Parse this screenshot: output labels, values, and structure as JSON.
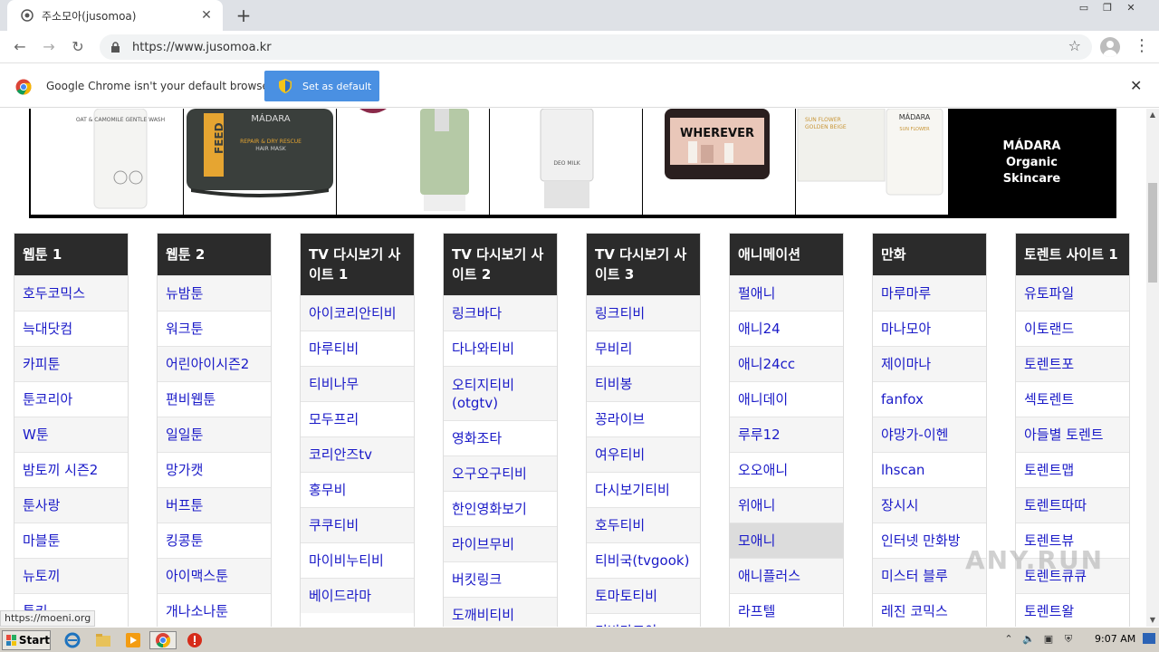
{
  "browser": {
    "tab_title": "주소모아(jusomoa)",
    "url": "https://www.jusomoa.kr"
  },
  "infobar": {
    "message": "Google Chrome isn't your default browser",
    "button": "Set as default"
  },
  "banner": {
    "ad_text": "MÁDARA\nOrganic\nSkincare",
    "product_labels": [
      "OAT & CAMOMILE GENTLE WASH",
      "MÁDARA REPAIR & DRY RESCUE HAIR MASK",
      "",
      "DEO MILK",
      "WHEREVER",
      "MÁDARA SUN FLOWER GOLDEN BEIGE"
    ]
  },
  "columns": [
    {
      "title": "웹툰 1",
      "items": [
        "호두코믹스",
        "늑대닷컴",
        "카피툰",
        "툰코리아",
        "W툰",
        "밤토끼 시즌2",
        "툰사랑",
        "마블툰",
        "뉴토끼",
        "툰키"
      ]
    },
    {
      "title": "웹툰 2",
      "items": [
        "뉴밤툰",
        "워크툰",
        "어린아이시즌2",
        "편비웹툰",
        "일일툰",
        "망가캣",
        "버프툰",
        "킹콩툰",
        "아이맥스툰",
        "개나소나툰"
      ]
    },
    {
      "title": "TV 다시보기 사이트 1",
      "items": [
        "아이코리안티비",
        "마루티비",
        "티비나무",
        "모두프리",
        "코리안즈tv",
        "홍무비",
        "쿠쿠티비",
        "마이비누티비",
        "베이드라마"
      ]
    },
    {
      "title": "TV 다시보기 사이트 2",
      "items": [
        "링크바다",
        "다나와티비",
        "오티지티비(otgtv)",
        "영화조타",
        "오구오구티비",
        "한인영화보기",
        "라이브무비",
        "버킷링크",
        "도깨비티비"
      ]
    },
    {
      "title": "TV 다시보기 사이트 3",
      "items": [
        "링크티비",
        "무비리",
        "티비봉",
        "꽁라이브",
        "여우티비",
        "다시보기티비",
        "호두티비",
        "티비국(tvgook)",
        "토마토티비",
        "티비다모아"
      ]
    },
    {
      "title": "애니메이션",
      "items": [
        "펄애니",
        "애니24",
        "애니24cc",
        "애니데이",
        "루루12",
        "오오애니",
        "위애니",
        "모애니",
        "애니플러스",
        "라프텔"
      ]
    },
    {
      "title": "만화",
      "items": [
        "마루마루",
        "마나모아",
        "제이마나",
        "fanfox",
        "야망가-이헨",
        "lhscan",
        "장시시",
        "인터넷 만화방",
        "미스터 블루",
        "레진 코믹스"
      ]
    },
    {
      "title": "토렌트 사이트 1",
      "items": [
        "유토파일",
        "이토랜드",
        "토렌트포",
        "섹토렌트",
        "아들별 토렌트",
        "토렌트맵",
        "토렌트따따",
        "토렌트뷰",
        "토렌트큐큐",
        "토렌트왈"
      ]
    }
  ],
  "status_url": "https://moeni.org",
  "watermark": "ANY.RUN",
  "taskbar": {
    "start": "Start",
    "clock": "9:07 AM"
  }
}
